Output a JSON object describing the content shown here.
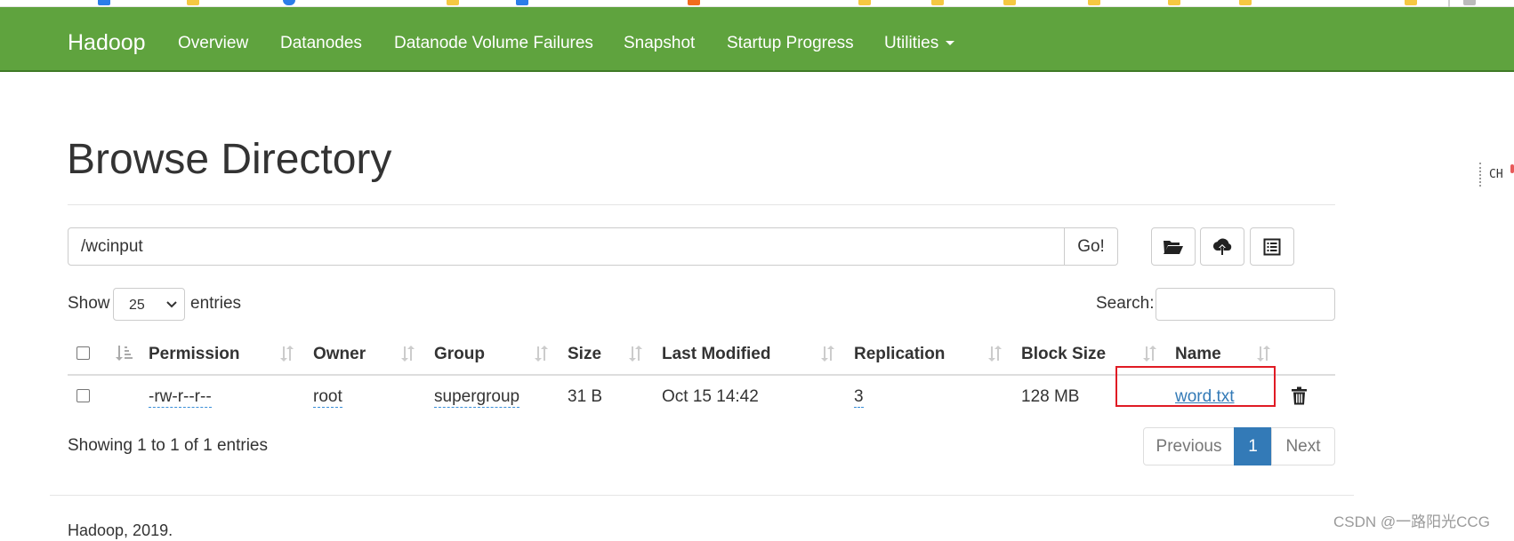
{
  "navbar": {
    "brand": "Hadoop",
    "items": [
      {
        "label": "Overview"
      },
      {
        "label": "Datanodes"
      },
      {
        "label": "Datanode Volume Failures"
      },
      {
        "label": "Snapshot"
      },
      {
        "label": "Startup Progress"
      },
      {
        "label": "Utilities"
      }
    ]
  },
  "page": {
    "title": "Browse Directory"
  },
  "path_bar": {
    "value": "/wcinput",
    "go_label": "Go!",
    "icons": [
      "folder-open-icon",
      "cloud-upload-icon",
      "list-icon"
    ]
  },
  "table_controls": {
    "show_label": "Show",
    "entries_value": "25",
    "entries_label": "entries",
    "search_label": "Search:"
  },
  "table": {
    "columns": [
      "Permission",
      "Owner",
      "Group",
      "Size",
      "Last Modified",
      "Replication",
      "Block Size",
      "Name"
    ],
    "rows": [
      {
        "permission": "-rw-r--r--",
        "owner": "root",
        "group": "supergroup",
        "size": "31 B",
        "last_modified": "Oct 15 14:42",
        "replication": "3",
        "block_size": "128 MB",
        "name": "word.txt"
      }
    ],
    "info": "Showing 1 to 1 of 1 entries"
  },
  "pagination": {
    "previous": "Previous",
    "current": "1",
    "next": "Next"
  },
  "footer": {
    "text": "Hadoop, 2019."
  },
  "ime_indicator": "CH",
  "watermark": "CSDN @一路阳光CCG",
  "colors": {
    "navbar": "#5fa33e",
    "link": "#337ab7",
    "active_page": "#337ab7",
    "highlight": "#e01b24"
  }
}
